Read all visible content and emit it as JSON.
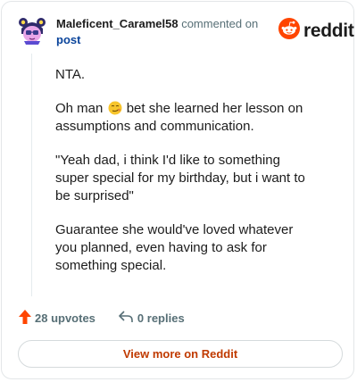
{
  "comment": {
    "username": "Maleficent_Caramel58",
    "action_text": "commented on",
    "target_link": "post",
    "paragraphs": [
      "NTA.",
      "\"Yeah dad, i think I'd like to something super special for my birthday, but i want to be surprised\"",
      "Guarantee she would've loved whatever you planned, even having to ask for something special."
    ],
    "paragraph_emoji": {
      "before": "Oh man",
      "after": "bet she learned her lesson on assumptions and communication.",
      "emoji_icon": "smirk-face-emoji"
    }
  },
  "brand": {
    "name": "reddit",
    "accent": "#ff4500"
  },
  "footer": {
    "upvotes": "28 upvotes",
    "replies": "0 replies"
  },
  "view_button": "View more on Reddit"
}
